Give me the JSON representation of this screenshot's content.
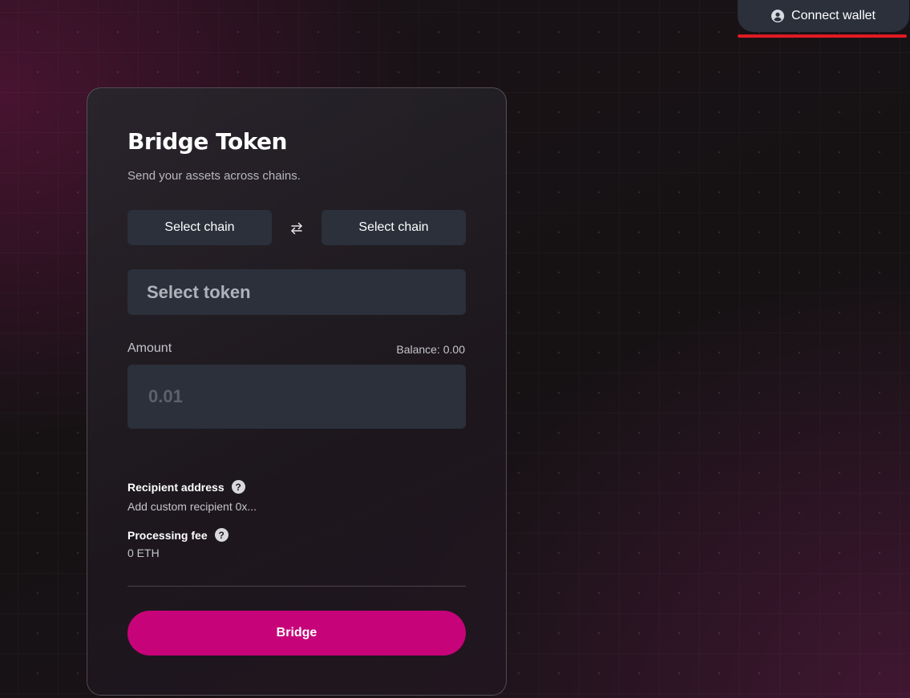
{
  "header": {
    "connect_wallet_label": "Connect wallet",
    "connect_wallet_icon": "user-circle-icon"
  },
  "bridge_card": {
    "title": "Bridge Token",
    "subtitle": "Send your assets across chains.",
    "from_chain_label": "Select chain",
    "to_chain_label": "Select chain",
    "swap_icon": "swap-arrows-icon",
    "token_select_label": "Select token",
    "amount_label": "Amount",
    "balance_label": "Balance: 0.00",
    "amount_placeholder": "0.01",
    "amount_value": "",
    "recipient_label": "Recipient address",
    "recipient_placeholder": "Add custom recipient 0x...",
    "recipient_value": "",
    "fee_label": "Processing fee",
    "fee_value": "0 ETH",
    "help_icon_glyph": "?",
    "bridge_button_label": "Bridge"
  },
  "colors": {
    "accent": "#c7037a",
    "input_bg": "#2b303b",
    "highlight_underline": "#e11b22"
  }
}
